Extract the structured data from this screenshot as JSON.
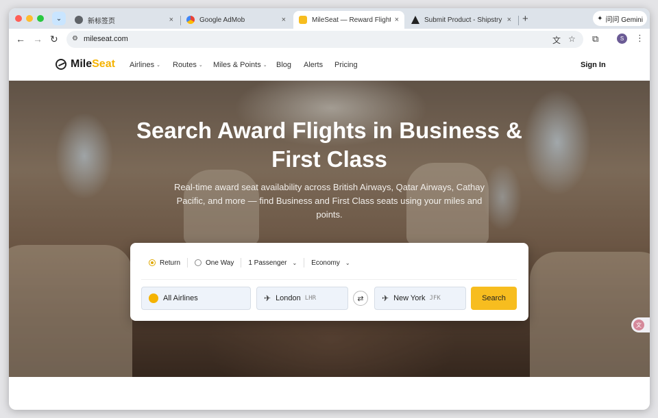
{
  "browser": {
    "search_tabs_glyph": "⌄",
    "tabs": [
      {
        "title": "新标签页",
        "favicon": "chrome-icon",
        "active": false
      },
      {
        "title": "Google AdMob",
        "favicon": "admob-icon",
        "active": false
      },
      {
        "title": "MileSeat — Reward Flight Availability",
        "favicon": "mileseat-icon",
        "active": true
      },
      {
        "title": "Submit Product - Shipstry",
        "favicon": "shipstry-icon",
        "active": false
      }
    ],
    "tab_close_glyph": "×",
    "new_tab_glyph": "+",
    "gemini_label": "问问 Gemini",
    "url": "mileseat.com",
    "profile_initial": "S"
  },
  "site": {
    "logo": {
      "part1": "Mile",
      "part2": "Seat"
    },
    "nav": [
      {
        "label": "Airlines",
        "dropdown": true
      },
      {
        "label": "Routes",
        "dropdown": true
      },
      {
        "label": "Miles & Points",
        "dropdown": true
      },
      {
        "label": "Blog",
        "dropdown": false
      },
      {
        "label": "Alerts",
        "dropdown": false
      },
      {
        "label": "Pricing",
        "dropdown": false
      }
    ],
    "sign_in": "Sign In",
    "accent_color": "#f7bd1f"
  },
  "hero": {
    "title": "Search Award Flights in Business & First Class",
    "subtitle": "Real-time award seat availability across British Airways, Qatar Airways, Cathay Pacific, and more — find Business and First Class seats using your miles and points."
  },
  "search": {
    "trip_type": {
      "return_label": "Return",
      "one_way_label": "One Way",
      "selected": "Return"
    },
    "passengers": "1 Passenger",
    "cabin": "Economy",
    "airline": "All Airlines",
    "origin": {
      "city": "London",
      "code": "LHR"
    },
    "destination": {
      "city": "New York",
      "code": "JFK"
    },
    "button": "Search"
  }
}
